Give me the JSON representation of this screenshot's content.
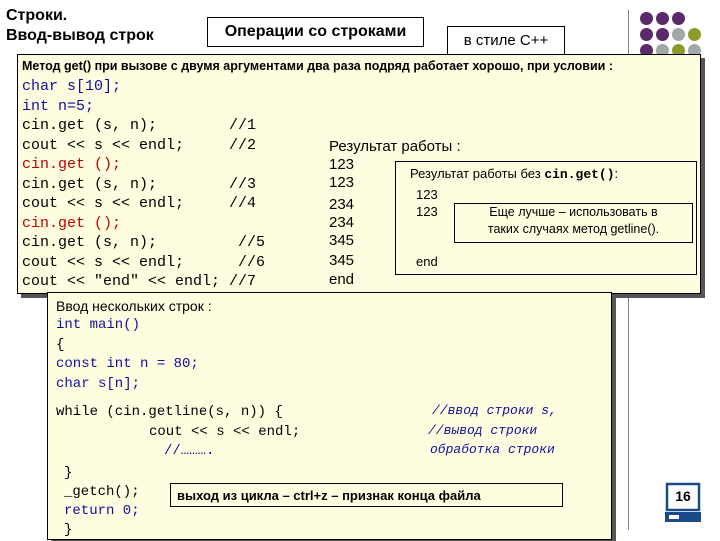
{
  "slide": {
    "title_line1": "Строки.",
    "title_line2": "Ввод-вывод строк",
    "box_operations": "Операции со строками",
    "box_style": "в стиле С++",
    "page_number": "16"
  },
  "main_box": {
    "heading": "Метод get() при вызове с двумя аргументами два раза подряд работает хорошо, при условии :",
    "code": [
      "char s[10];",
      "int n=5;",
      "cin.get (s, n);        //1",
      "cout << s << endl;     //2",
      "cin.get ();",
      "cin.get (s, n);        //3",
      "cout << s << endl;     //4",
      "cin.get ();",
      "cin.get (s, n);         //5",
      "cout << s << endl;      //6",
      "cout << \"end\" << endl; //7"
    ],
    "result_label": "Результат работы :",
    "results": [
      "123",
      "123",
      "234",
      "234",
      "345",
      "345",
      "end"
    ],
    "inner_box": {
      "label_prefix": "Результат работы без ",
      "label_code": "cin.get()",
      "label_suffix": ":",
      "values": [
        "123",
        "123"
      ],
      "end": "end",
      "tip_line1": "Еще лучше – использовать в",
      "tip_line2": "таких случаях метод getline()."
    }
  },
  "lower_box": {
    "heading": "Ввод нескольких строк :",
    "code": [
      "int main()",
      "{",
      "const int n = 80;",
      "char s[n];"
    ],
    "while_line": "while (cin.getline(s, n)) {",
    "cout_line": "cout << s << endl;",
    "dots_line": "//……….",
    "close_brace": "}",
    "getch_line": "_getch();",
    "return_line": "return 0;",
    "final_brace": "}",
    "comments": [
      "//ввод строки s,",
      "//вывод строки",
      "обработка строки"
    ],
    "loop_note": "выход из цикла – ctrl+z – признак конца файла"
  },
  "colors": {
    "box_fill": "#fffde0",
    "keyword": "#1010a0",
    "dot_purple": "#5a2a6a",
    "dot_grey": "#a0a8a8",
    "dot_olive": "#8c9a2a"
  }
}
